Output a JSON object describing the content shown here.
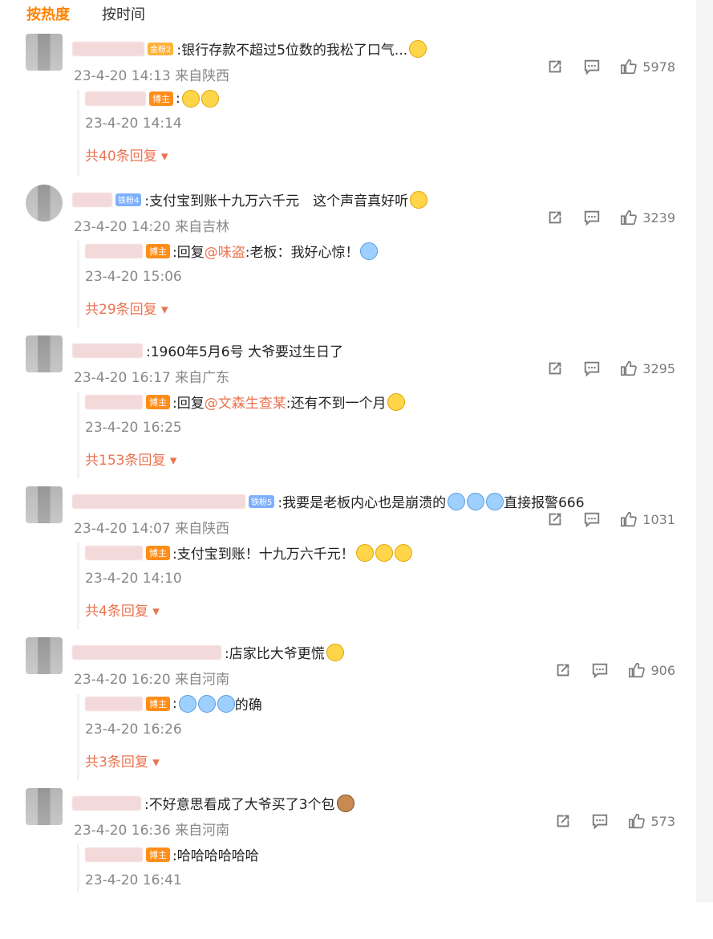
{
  "tabs": {
    "hot": "按热度",
    "time": "按时间"
  },
  "comments": [
    {
      "badge": "金粉2",
      "text": ":银行存款不超过5位数的我松了口气...",
      "meta": "23-4-20 14:13 来自陕西",
      "likes": "5978",
      "reply": {
        "badge": "博主",
        "text": ":",
        "time": "23-4-20 14:14",
        "more": "共40条回复"
      }
    },
    {
      "badge": "铁粉4",
      "text": ":支付宝到账十九万六千元　这个声音真好听",
      "meta": "23-4-20 14:20 来自吉林",
      "likes": "3239",
      "reply": {
        "badge": "博主",
        "pre": ":回复",
        "mention": "@味盗",
        "text": ":老板：我好心惊！",
        "time": "23-4-20 15:06",
        "more": "共29条回复"
      }
    },
    {
      "badge": "",
      "text": ":1960年5月6号 大爷要过生日了",
      "meta": "23-4-20 16:17 来自广东",
      "likes": "3295",
      "reply": {
        "badge": "博主",
        "pre": ":回复",
        "mention": "@文森生查某",
        "text": ":还有不到一个月",
        "time": "23-4-20 16:25",
        "more": "共153条回复"
      }
    },
    {
      "badge": "铁粉5",
      "text": ":我要是老板内心也是崩溃的",
      "text2": "直接报警666",
      "meta": "23-4-20 14:07 来自陕西",
      "likes": "1031",
      "reply": {
        "badge": "博主",
        "text": ":支付宝到账！十九万六千元！",
        "time": "23-4-20 14:10",
        "more": "共4条回复"
      }
    },
    {
      "badge": "",
      "text": ":店家比大爷更慌",
      "meta": "23-4-20 16:20 来自河南",
      "likes": "906",
      "reply": {
        "badge": "博主",
        "text": ":",
        "text2": "的确",
        "time": "23-4-20 16:26",
        "more": "共3条回复"
      }
    },
    {
      "badge": "",
      "text": ":不好意思看成了大爷买了3个包",
      "meta": "23-4-20 16:36 来自河南",
      "likes": "573",
      "reply": {
        "badge": "博主",
        "text": ":哈哈哈哈哈哈",
        "time": "23-4-20 16:41",
        "more": ""
      }
    }
  ],
  "icons": {
    "share": "share-icon",
    "comment": "comment-icon",
    "like": "like-icon",
    "more": "dropdown-arrow-icon"
  }
}
